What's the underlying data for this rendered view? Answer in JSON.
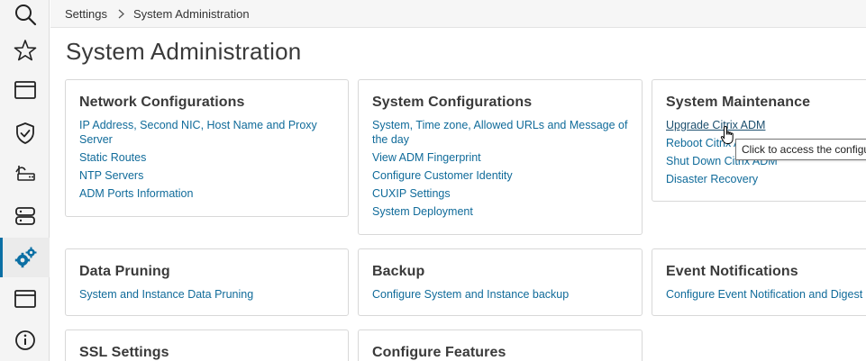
{
  "breadcrumb": {
    "items": [
      "Settings",
      "System Administration"
    ]
  },
  "page": {
    "title": "System Administration"
  },
  "sidebar": {
    "items": [
      {
        "name": "search-icon",
        "active": false
      },
      {
        "name": "star-icon",
        "active": false
      },
      {
        "name": "window-icon",
        "active": false
      },
      {
        "name": "shield-icon",
        "active": false
      },
      {
        "name": "network-icon",
        "active": false
      },
      {
        "name": "servers-icon",
        "active": false
      },
      {
        "name": "gears-icon",
        "active": true
      },
      {
        "name": "window-icon",
        "active": false
      },
      {
        "name": "info-icon",
        "active": false
      }
    ]
  },
  "cards": {
    "network": {
      "title": "Network Configurations",
      "links": [
        "IP Address, Second NIC, Host Name and Proxy Server",
        "Static Routes",
        "NTP Servers",
        "ADM Ports Information"
      ]
    },
    "system": {
      "title": "System Configurations",
      "links": [
        "System, Time zone, Allowed URLs and Message of the day",
        "View ADM Fingerprint",
        "Configure Customer Identity",
        "CUXIP Settings",
        "System Deployment"
      ]
    },
    "maintenance": {
      "title": "System Maintenance",
      "links": [
        "Upgrade Citrix ADM",
        "Reboot Citrix ADM",
        "Shut Down Citrix ADM",
        "Disaster Recovery"
      ]
    },
    "pruning": {
      "title": "Data Pruning",
      "links": [
        "System and Instance Data Pruning"
      ]
    },
    "backup": {
      "title": "Backup",
      "links": [
        "Configure System and Instance backup"
      ]
    },
    "events": {
      "title": "Event Notifications",
      "links": [
        "Configure Event Notification and Digest"
      ]
    },
    "ssl": {
      "title": "SSL Settings",
      "links": []
    },
    "features": {
      "title": "Configure Features",
      "links": []
    }
  },
  "tooltip": {
    "text": "Click to access the configu"
  },
  "colors": {
    "link": "#106b9a",
    "accent": "#0b6fa4",
    "title": "#3a3a3a"
  }
}
